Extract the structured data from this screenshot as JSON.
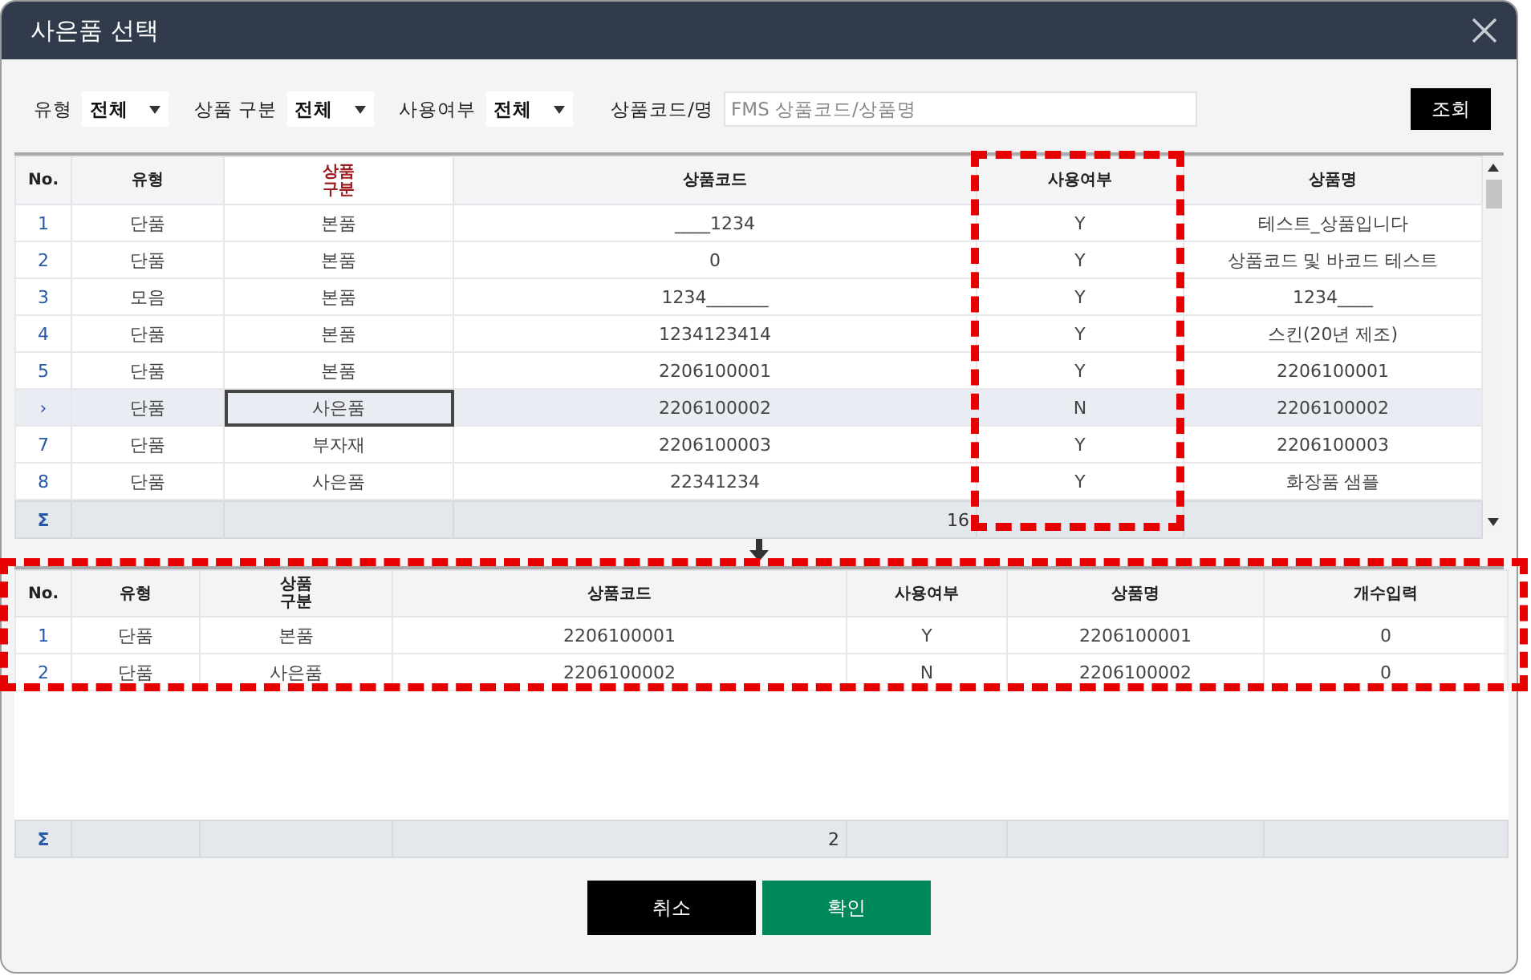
{
  "window": {
    "title": "사은품 선택"
  },
  "filters": [
    {
      "kind": "select",
      "label": "유형",
      "value": "전체"
    },
    {
      "kind": "select",
      "label": "상품 구분",
      "value": "전체"
    },
    {
      "kind": "select",
      "label": "사용여부",
      "value": "전체"
    },
    {
      "kind": "text",
      "label": "상품코드/명",
      "placeholder": "FMS 상품코드/상품명"
    }
  ],
  "search_button": "조회",
  "product_grid": {
    "columns": [
      {
        "label": "No.",
        "highlighted": false
      },
      {
        "label": "유형",
        "highlighted": false
      },
      {
        "label": "상품\n구분",
        "highlighted": true
      },
      {
        "label": "상품코드",
        "highlighted": false
      },
      {
        "label": "사용여부",
        "highlighted": false
      },
      {
        "label": "상품명",
        "highlighted": false
      }
    ],
    "rows": [
      {
        "cells": [
          "1",
          "단품",
          "본품",
          "____1234",
          "Y",
          "테스트_상품입니다"
        ],
        "selected": false,
        "cell_focused": false
      },
      {
        "cells": [
          "2",
          "단품",
          "본품",
          "0",
          "Y",
          "상품코드 및 바코드 테스트"
        ],
        "selected": false,
        "cell_focused": false
      },
      {
        "cells": [
          "3",
          "모음",
          "본품",
          "1234_______",
          "Y",
          "1234____"
        ],
        "selected": false,
        "cell_focused": false
      },
      {
        "cells": [
          "4",
          "단품",
          "본품",
          "1234123414",
          "Y",
          "스킨(20년 제조)"
        ],
        "selected": false,
        "cell_focused": false
      },
      {
        "cells": [
          "5",
          "단품",
          "본품",
          "2206100001",
          "Y",
          "2206100001"
        ],
        "selected": false,
        "cell_focused": false
      },
      {
        "cells": [
          "›",
          "단품",
          "사은품",
          "2206100002",
          "N",
          "2206100002"
        ],
        "selected": true,
        "cell_focused": true
      },
      {
        "cells": [
          "7",
          "단품",
          "부자재",
          "2206100003",
          "Y",
          "2206100003"
        ],
        "selected": false,
        "cell_focused": false
      },
      {
        "cells": [
          "8",
          "단품",
          "사은품",
          "22341234",
          "Y",
          "화장품 샘플"
        ],
        "selected": false,
        "cell_focused": false
      }
    ],
    "summary": {
      "symbol": "Σ",
      "value": "16"
    }
  },
  "selected_grid": {
    "columns": [
      {
        "label": "No.",
        "highlighted": false
      },
      {
        "label": "유형",
        "highlighted": false
      },
      {
        "label": "상품\n구분",
        "highlighted": false
      },
      {
        "label": "상품코드",
        "highlighted": false
      },
      {
        "label": "사용여부",
        "highlighted": false
      },
      {
        "label": "상품명",
        "highlighted": false
      },
      {
        "label": "개수입력",
        "highlighted": false
      }
    ],
    "rows": [
      {
        "cells": [
          "1",
          "단품",
          "본품",
          "2206100001",
          "Y",
          "2206100001",
          "0"
        ],
        "selected": false,
        "cell_focused": false
      },
      {
        "cells": [
          "2",
          "단품",
          "사은품",
          "2206100002",
          "N",
          "2206100002",
          "0"
        ],
        "selected": false,
        "cell_focused": false
      }
    ],
    "summary": {
      "symbol": "Σ",
      "value": "2"
    }
  },
  "buttons": [
    {
      "kind": "cancel",
      "label": "취소"
    },
    {
      "kind": "confirm",
      "label": "확인"
    }
  ]
}
